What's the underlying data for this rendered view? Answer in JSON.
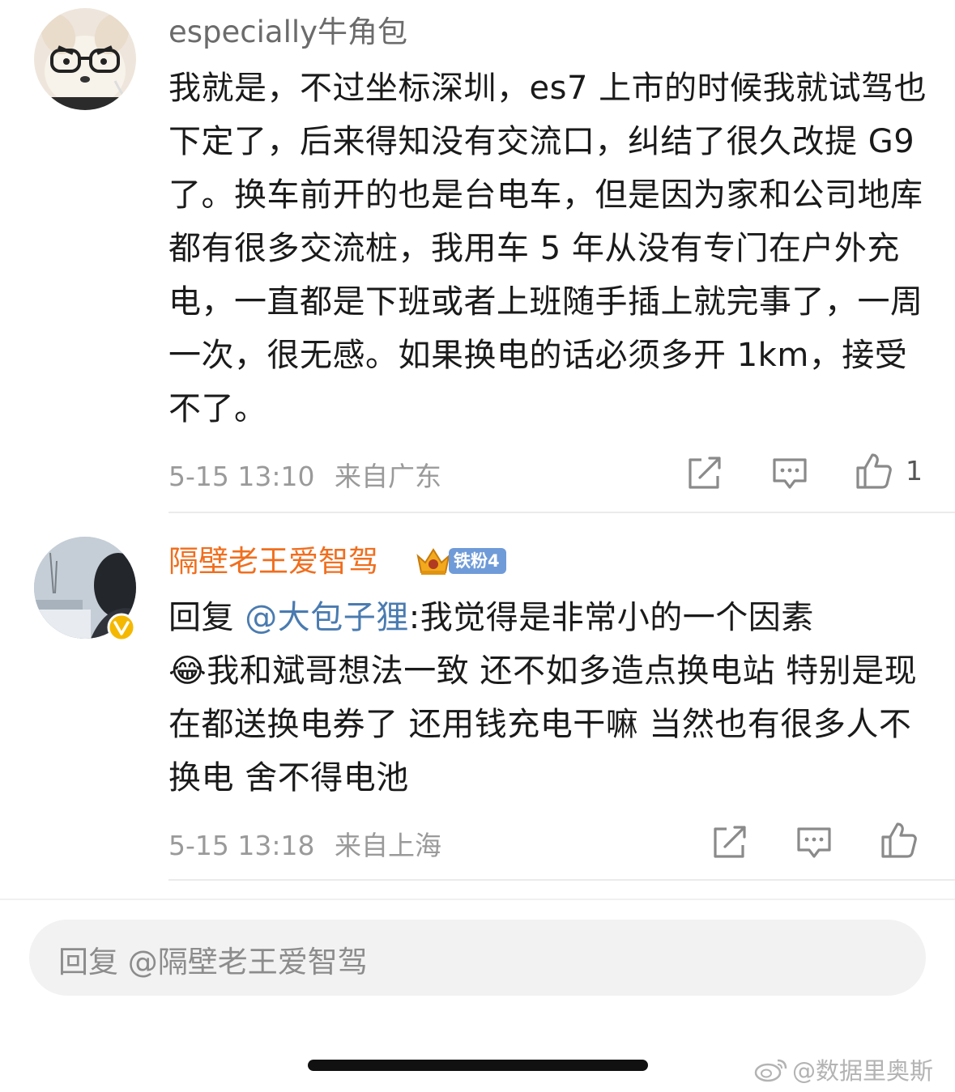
{
  "comments": [
    {
      "username": "especially牛角包",
      "body": "我就是，不过坐标深圳，es7 上市的时候我就试驾也下定了，后来得知没有交流口，纠结了很久改提 G9 了。换车前开的也是台电车，但是因为家和公司地库都有很多交流桩，我用车 5 年从没有专门在户外充电，一直都是下班或者上班随手插上就完事了，一周一次，很无感。如果换电的话必须多开 1km，接受不了。",
      "time": "5-15 13:10",
      "location": "来自广东",
      "like_count": "1"
    },
    {
      "username": "隔壁老王爱智驾",
      "fan_badge": "铁粉4",
      "reply_prefix": "回复",
      "mention": "@大包子狸",
      "body": ":我觉得是非常小的一个因素",
      "emoji": "😂",
      "body2": "我和斌哥想法一致 还不如多造点换电站 特别是现在都送换电券了 还用钱充电干嘛 当然也有很多人不换电 舍不得电池",
      "time": "5-15 13:18",
      "location": "来自上海",
      "verified": true
    }
  ],
  "reply_input": {
    "placeholder": "回复 @隔壁老王爱智驾"
  },
  "watermark": "@数据里奥斯",
  "colors": {
    "username_orange": "#f06e1e",
    "mention_blue": "#4a7bb0",
    "meta_gray": "#9a9a9a",
    "badge_blue": "#6f9bd8",
    "verified_gold": "#f5b800"
  }
}
